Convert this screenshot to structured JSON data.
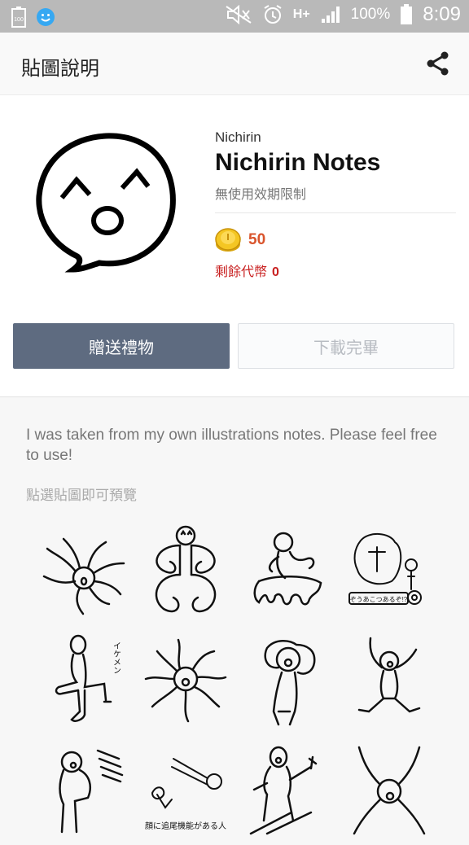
{
  "status_bar": {
    "battery_pct": "100%",
    "time": "8:09",
    "network": "H+",
    "small_batt": "100"
  },
  "app_bar": {
    "title": "貼圖說明"
  },
  "product": {
    "author": "Nichirin",
    "name": "Nichirin Notes",
    "validity": "無使用效期限制",
    "price": "50",
    "remaining_label": "剩餘代幣",
    "remaining_value": "0"
  },
  "buttons": {
    "gift": "贈送禮物",
    "download": "下載完畢"
  },
  "description": "I was taken from my own illustrations notes. Please feel free to use!",
  "preview_hint": "點選貼圖即可預覽",
  "sticker_text": {
    "s4": "ぞうあこつあるぞ!?",
    "s5": "イケメン",
    "s10": "顔に追尾機能がある人"
  },
  "colors": {
    "gift_button": "#5e6b80",
    "price": "#d9542c",
    "remaining": "#c81f1f",
    "statusbar": "#b9b9b9"
  }
}
